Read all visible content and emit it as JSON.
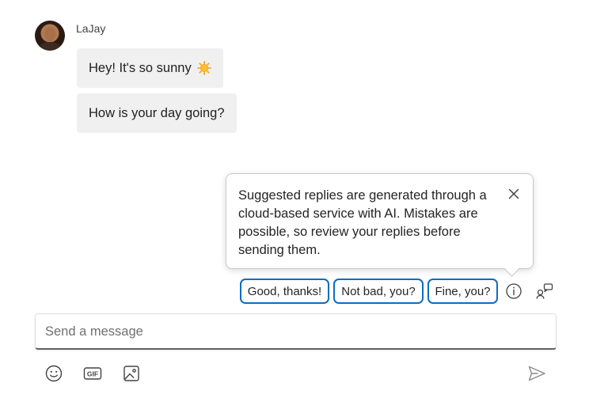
{
  "conversation": {
    "sender_name": "LaJay",
    "messages": [
      {
        "text": "Hey! It's so sunny",
        "emoji": "sun-emoji"
      },
      {
        "text": "How is your day going?"
      }
    ]
  },
  "tooltip": {
    "text": "Suggested replies are generated through a cloud-based service with AI. Mistakes are possible, so review your replies before sending them.",
    "close_icon": "close-icon"
  },
  "suggested_replies": [
    "Good, thanks!",
    "Not bad, you?",
    "Fine, you?"
  ],
  "icons": {
    "info": "info-icon",
    "suggested_replies_toggle": "suggested-replies-icon",
    "emoji": "emoji-icon",
    "gif": "gif-icon",
    "image": "image-icon",
    "send": "send-icon"
  },
  "gif_icon_label": "GIF",
  "composer": {
    "placeholder": "Send a message",
    "value": ""
  },
  "colors": {
    "accent": "#0f6cbd",
    "bubble": "#f0f0f0",
    "sun": "#f5a623"
  }
}
